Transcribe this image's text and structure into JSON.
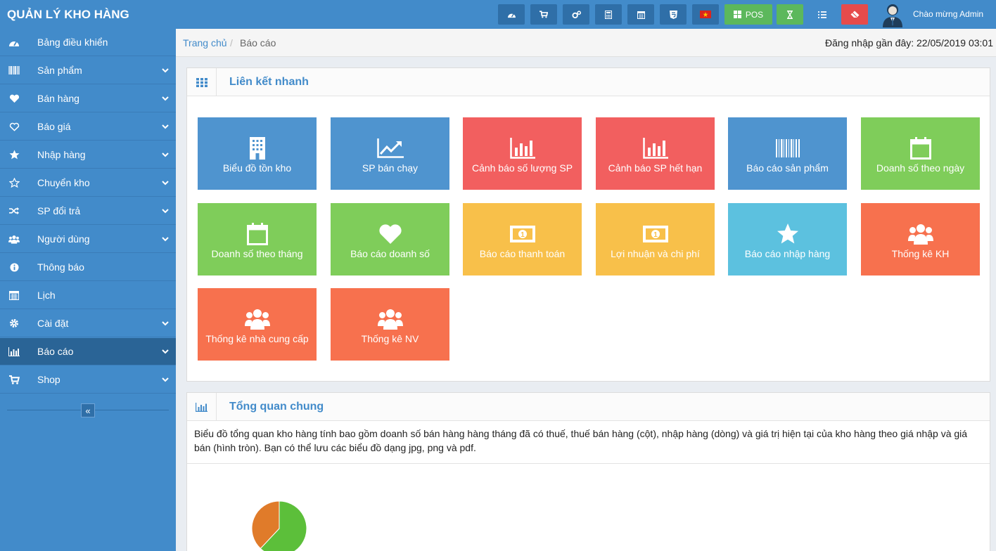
{
  "app": {
    "title": "QUẢN LÝ KHO HÀNG"
  },
  "topbar": {
    "buttons": [
      {
        "icon": "dashboard-icon"
      },
      {
        "icon": "cart-icon"
      },
      {
        "icon": "cogs-icon"
      },
      {
        "icon": "calculator-icon"
      },
      {
        "icon": "calendar-icon"
      },
      {
        "icon": "html5-icon"
      },
      {
        "icon": "vietnam-flag-icon"
      },
      {
        "icon": "grid-icon",
        "label": "POS"
      },
      {
        "icon": "hourglass-icon"
      },
      {
        "icon": "list-icon"
      },
      {
        "icon": "eraser-icon"
      }
    ],
    "welcome": "Chào mừng Admin"
  },
  "sidebar": {
    "items": [
      {
        "label": "Bảng điều khiển",
        "icon": "dashboard-icon",
        "has_children": false
      },
      {
        "label": "Sản phẩm",
        "icon": "barcode-icon",
        "has_children": true
      },
      {
        "label": "Bán hàng",
        "icon": "heart-icon",
        "has_children": true
      },
      {
        "label": "Báo giá",
        "icon": "heart-outline-icon",
        "has_children": true
      },
      {
        "label": "Nhập hàng",
        "icon": "star-icon",
        "has_children": true
      },
      {
        "label": "Chuyển kho",
        "icon": "star-outline-icon",
        "has_children": true
      },
      {
        "label": "SP đổi trả",
        "icon": "random-icon",
        "has_children": true
      },
      {
        "label": "Người dùng",
        "icon": "users-icon",
        "has_children": true
      },
      {
        "label": "Thông báo",
        "icon": "info-icon",
        "has_children": false
      },
      {
        "label": "Lịch",
        "icon": "calendar-icon",
        "has_children": false
      },
      {
        "label": "Cài đặt",
        "icon": "gear-icon",
        "has_children": true
      },
      {
        "label": "Báo cáo",
        "icon": "bar-chart-icon",
        "has_children": true,
        "active": true
      },
      {
        "label": "Shop",
        "icon": "cart-icon",
        "has_children": true
      }
    ],
    "collapse_glyph": "«"
  },
  "breadcrumb": {
    "home": "Trang chủ",
    "separator": "/",
    "current": "Báo cáo",
    "last_login": "Đăng nhập gần đây: 22/05/2019 03:01"
  },
  "quick_links": {
    "title": "Liên kết nhanh",
    "tiles": [
      {
        "label": "Biểu đồ tồn kho",
        "icon": "building-icon",
        "color": "blue"
      },
      {
        "label": "SP bán chạy",
        "icon": "trend-chart-icon",
        "color": "blue"
      },
      {
        "label": "Cảnh báo số lượng SP",
        "icon": "bar-chart-icon",
        "color": "red"
      },
      {
        "label": "Cảnh báo SP hết hạn",
        "icon": "bar-chart-icon",
        "color": "red"
      },
      {
        "label": "Báo cáo sản phẩm",
        "icon": "barcode-icon",
        "color": "blue"
      },
      {
        "label": "Doanh số theo ngày",
        "icon": "calendar-icon",
        "color": "green"
      },
      {
        "label": "Doanh số theo tháng",
        "icon": "calendar-icon",
        "color": "green"
      },
      {
        "label": "Báo cáo doanh số",
        "icon": "heart-icon",
        "color": "green"
      },
      {
        "label": "Báo cáo thanh toán",
        "icon": "money-icon",
        "color": "yellow"
      },
      {
        "label": "Lợi nhuận và chi phí",
        "icon": "money-icon",
        "color": "yellow"
      },
      {
        "label": "Báo cáo nhập hàng",
        "icon": "star-icon",
        "color": "cyan"
      },
      {
        "label": "Thống kê KH",
        "icon": "users-icon",
        "color": "orange"
      },
      {
        "label": "Thống kê nhà cung cấp",
        "icon": "users-icon",
        "color": "orange"
      },
      {
        "label": "Thống kê NV",
        "icon": "users-icon",
        "color": "orange"
      }
    ]
  },
  "overview": {
    "title": "Tổng quan chung",
    "description": "Biểu đồ tổng quan kho hàng tính bao gồm doanh số bán hàng hàng tháng đã có thuế, thuế bán hàng (cột), nhập hàng (dòng) và giá trị hiện tại của kho hàng theo giá nhập và giá bán (hình tròn). Bạn có thể lưu các biểu đồ dạng jpg, png và pdf."
  },
  "chart_data": {
    "type": "pie",
    "slices": [
      {
        "value": 0.62,
        "color": "#5cbf3a"
      },
      {
        "value": 0.38,
        "color": "#e07b2a"
      }
    ]
  }
}
